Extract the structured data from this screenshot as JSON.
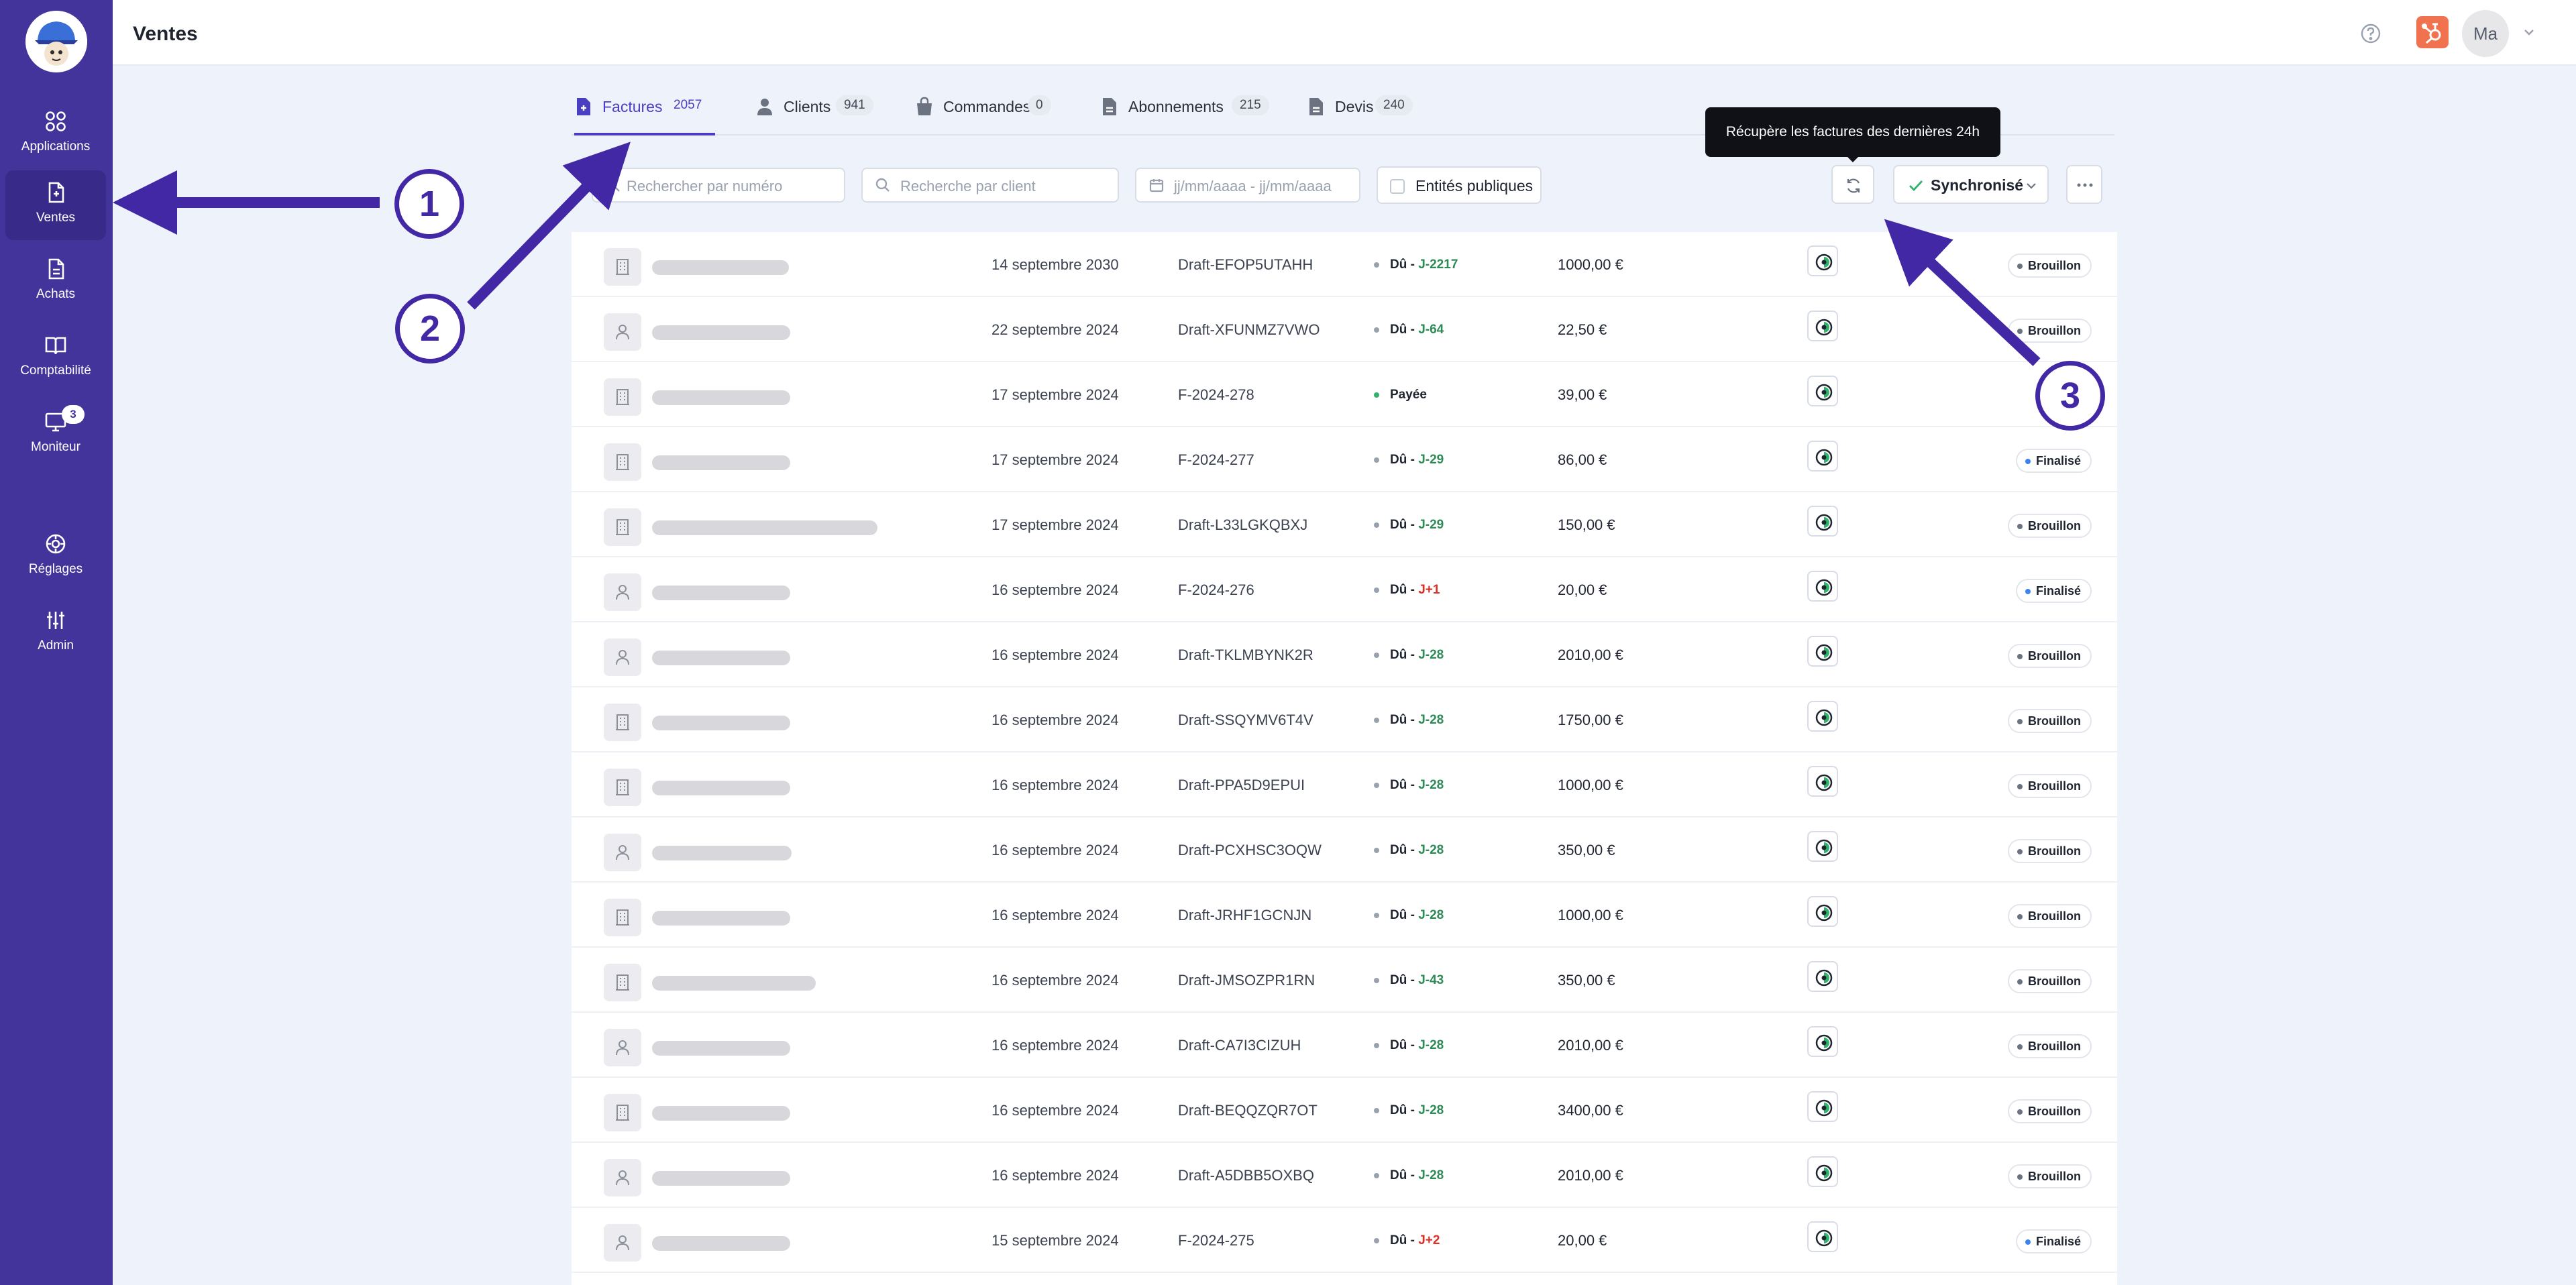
{
  "app": {
    "page_title": "Ventes",
    "user_initials": "Ma"
  },
  "sidebar": {
    "items": [
      {
        "label": "Applications",
        "icon": "grid-icon"
      },
      {
        "label": "Ventes",
        "icon": "invoice-icon",
        "active": true
      },
      {
        "label": "Achats",
        "icon": "document-icon"
      },
      {
        "label": "Comptabilité",
        "icon": "book-icon"
      },
      {
        "label": "Moniteur",
        "icon": "monitor-icon",
        "badge": "3"
      },
      {
        "label": "Réglages",
        "icon": "settings-icon"
      },
      {
        "label": "Admin",
        "icon": "sliders-icon"
      }
    ]
  },
  "tabs": [
    {
      "label": "Factures",
      "count": "2057",
      "active": true
    },
    {
      "label": "Clients",
      "count": "941"
    },
    {
      "label": "Commandes",
      "count": "0"
    },
    {
      "label": "Abonnements",
      "count": "215"
    },
    {
      "label": "Devis",
      "count": "240"
    }
  ],
  "toolbar": {
    "search_number_placeholder": "Rechercher par numéro",
    "search_client_placeholder": "Recherche par client",
    "date_placeholder": "jj/mm/aaaa - jj/mm/aaaa",
    "public_entities_label": "Entités publiques",
    "sync_label": "Synchronisé",
    "refresh_tooltip": "Récupère les factures des dernières 24h"
  },
  "colors": {
    "accent": "#4a3fc0",
    "sidebar": "#43349c",
    "due_green": "#2e8b57",
    "due_red": "#d93025",
    "paid_dot": "#2fb36a",
    "draft_dot": "#6b7280",
    "final_dot": "#3b82f6"
  },
  "rows": [
    {
      "type": "company",
      "date": "14 septembre 2030",
      "number": "Draft-EFOP5UTAHH",
      "status": "Dû",
      "due": "J-2217",
      "due_tone": "green",
      "amount": "1000,00 €",
      "badge": "Brouillon"
    },
    {
      "type": "person",
      "date": "22 septembre 2024",
      "number": "Draft-XFUNMZ7VWO",
      "status": "Dû",
      "due": "J-64",
      "due_tone": "green",
      "amount": "22,50 €",
      "badge": "Brouillon"
    },
    {
      "type": "company",
      "date": "17 septembre 2024",
      "number": "F-2024-278",
      "status": "Payée",
      "due": "",
      "due_tone": "",
      "amount": "39,00 €",
      "badge": ""
    },
    {
      "type": "company",
      "date": "17 septembre 2024",
      "number": "F-2024-277",
      "status": "Dû",
      "due": "J-29",
      "due_tone": "green",
      "amount": "86,00 €",
      "badge": "Finalisé"
    },
    {
      "type": "company",
      "date": "17 septembre 2024",
      "number": "Draft-L33LGKQBXJ",
      "status": "Dû",
      "due": "J-29",
      "due_tone": "green",
      "amount": "150,00 €",
      "badge": "Brouillon"
    },
    {
      "type": "person",
      "date": "16 septembre 2024",
      "number": "F-2024-276",
      "status": "Dû",
      "due": "J+1",
      "due_tone": "red",
      "amount": "20,00 €",
      "badge": "Finalisé"
    },
    {
      "type": "person",
      "date": "16 septembre 2024",
      "number": "Draft-TKLMBYNK2R",
      "status": "Dû",
      "due": "J-28",
      "due_tone": "green",
      "amount": "2010,00 €",
      "badge": "Brouillon"
    },
    {
      "type": "company",
      "date": "16 septembre 2024",
      "number": "Draft-SSQYMV6T4V",
      "status": "Dû",
      "due": "J-28",
      "due_tone": "green",
      "amount": "1750,00 €",
      "badge": "Brouillon"
    },
    {
      "type": "company",
      "date": "16 septembre 2024",
      "number": "Draft-PPA5D9EPUI",
      "status": "Dû",
      "due": "J-28",
      "due_tone": "green",
      "amount": "1000,00 €",
      "badge": "Brouillon"
    },
    {
      "type": "person",
      "date": "16 septembre 2024",
      "number": "Draft-PCXHSC3OQW",
      "status": "Dû",
      "due": "J-28",
      "due_tone": "green",
      "amount": "350,00 €",
      "badge": "Brouillon"
    },
    {
      "type": "company",
      "date": "16 septembre 2024",
      "number": "Draft-JRHF1GCNJN",
      "status": "Dû",
      "due": "J-28",
      "due_tone": "green",
      "amount": "1000,00 €",
      "badge": "Brouillon"
    },
    {
      "type": "company",
      "date": "16 septembre 2024",
      "number": "Draft-JMSOZPR1RN",
      "status": "Dû",
      "due": "J-43",
      "due_tone": "green",
      "amount": "350,00 €",
      "badge": "Brouillon"
    },
    {
      "type": "person",
      "date": "16 septembre 2024",
      "number": "Draft-CA7I3CIZUH",
      "status": "Dû",
      "due": "J-28",
      "due_tone": "green",
      "amount": "2010,00 €",
      "badge": "Brouillon"
    },
    {
      "type": "company",
      "date": "16 septembre 2024",
      "number": "Draft-BEQQZQR7OT",
      "status": "Dû",
      "due": "J-28",
      "due_tone": "green",
      "amount": "3400,00 €",
      "badge": "Brouillon"
    },
    {
      "type": "person",
      "date": "16 septembre 2024",
      "number": "Draft-A5DBB5OXBQ",
      "status": "Dû",
      "due": "J-28",
      "due_tone": "green",
      "amount": "2010,00 €",
      "badge": "Brouillon"
    },
    {
      "type": "person",
      "date": "15 septembre 2024",
      "number": "F-2024-275",
      "status": "Dû",
      "due": "J+2",
      "due_tone": "red",
      "amount": "20,00 €",
      "badge": "Finalisé"
    }
  ],
  "callouts": [
    "1",
    "2",
    "3"
  ]
}
